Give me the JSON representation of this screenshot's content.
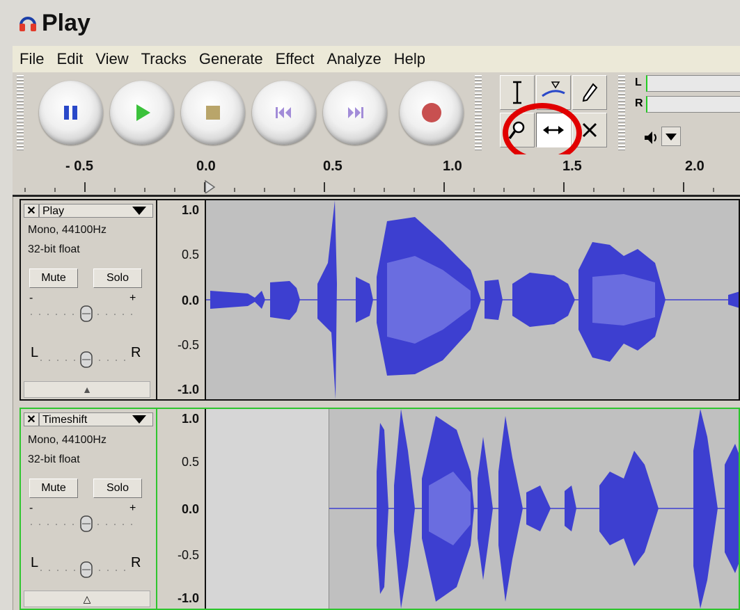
{
  "window": {
    "title": "Play"
  },
  "menu": [
    "File",
    "Edit",
    "View",
    "Tracks",
    "Generate",
    "Effect",
    "Analyze",
    "Help"
  ],
  "meter": {
    "left_label": "L",
    "right_label": "R"
  },
  "ruler": {
    "ticks": [
      "- 0.5",
      "0.0",
      "0.5",
      "1.0",
      "1.5",
      "2.0"
    ]
  },
  "tracks": [
    {
      "name": "Play",
      "info1": "Mono, 44100Hz",
      "info2": "32-bit float",
      "mute": "Mute",
      "solo": "Solo",
      "gain_minus": "-",
      "gain_plus": "+",
      "pan_left": "L",
      "pan_right": "R",
      "scale": [
        "1.0",
        "0.5",
        "0.0",
        "-0.5",
        "-1.0"
      ],
      "selected": false
    },
    {
      "name": "Timeshift",
      "info1": "Mono, 44100Hz",
      "info2": "32-bit float",
      "mute": "Mute",
      "solo": "Solo",
      "gain_minus": "-",
      "gain_plus": "+",
      "pan_left": "L",
      "pan_right": "R",
      "scale": [
        "1.0",
        "0.5",
        "0.0",
        "-0.5",
        "-1.0"
      ],
      "selected": true
    }
  ],
  "colors": {
    "wave_outer": "#3d3fd0",
    "wave_inner": "#6a6de0",
    "selected_track_border": "#2ec52e",
    "annotation": "#e10000"
  }
}
